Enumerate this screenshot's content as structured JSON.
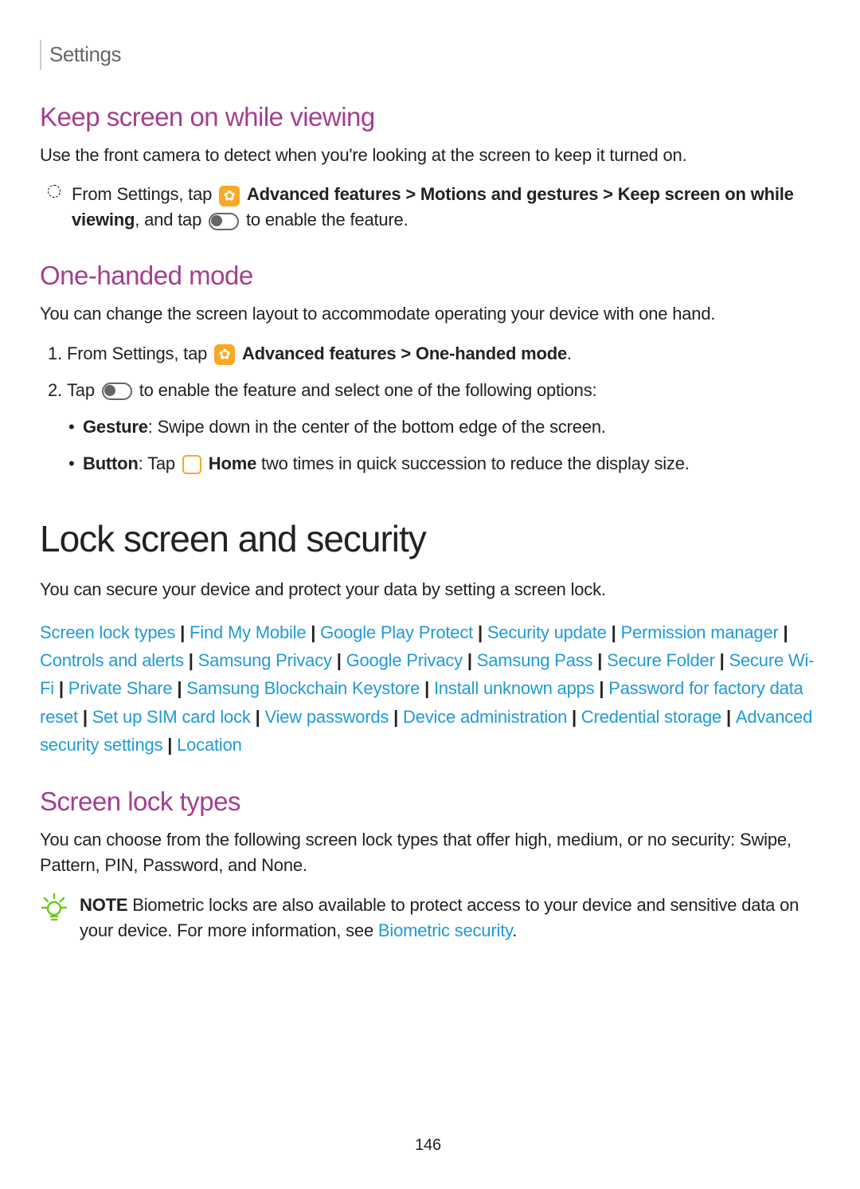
{
  "header": {
    "title": "Settings"
  },
  "keep": {
    "title": "Keep screen on while viewing",
    "desc": "Use the front camera to detect when you're looking at the screen to keep it turned on.",
    "step_a": "From Settings, tap ",
    "step_b": " Advanced features > Motions and gestures > Keep screen on while viewing",
    "step_c": ", and tap ",
    "step_d": " to enable the feature."
  },
  "one_handed": {
    "title": "One-handed mode",
    "desc": "You can change the screen layout to accommodate operating your device with one hand.",
    "s1a": "From Settings, tap ",
    "s1b": " Advanced features > One-handed mode",
    "s1c": ".",
    "s2a": "Tap ",
    "s2b": " to enable the feature and select one of the following options:",
    "gesture_label": "Gesture",
    "gesture_body": ": Swipe down in the center of the bottom edge of the screen.",
    "button_label": "Button",
    "button_body_a": ": Tap ",
    "button_home": " Home",
    "button_body_b": " two times in quick succession to reduce the display size."
  },
  "lock": {
    "title": "Lock screen and security",
    "desc": "You can secure your device and protect your data by setting a screen lock.",
    "links": [
      "Screen lock types",
      "Find My Mobile",
      "Google Play Protect",
      "Security update",
      "Permission manager",
      "Controls and alerts",
      "Samsung Privacy",
      "Google Privacy",
      "Samsung Pass",
      "Secure Folder",
      "Secure Wi-Fi",
      "Private Share",
      "Samsung Blockchain Keystore",
      "Install unknown apps",
      "Password for factory data reset",
      "Set up SIM card lock",
      "View passwords",
      "Device administration",
      "Credential storage",
      "Advanced security settings",
      "Location"
    ]
  },
  "screen_lock": {
    "title": "Screen lock types",
    "desc": "You can choose from the following screen lock types that offer high, medium, or no security: Swipe, Pattern, PIN, Password, and None.",
    "note_label": "NOTE",
    "note_a": "  Biometric locks are also available to protect access to your device and sensitive data on your device. For more information, see ",
    "note_link": "Biometric security",
    "note_b": "."
  },
  "page": "146"
}
